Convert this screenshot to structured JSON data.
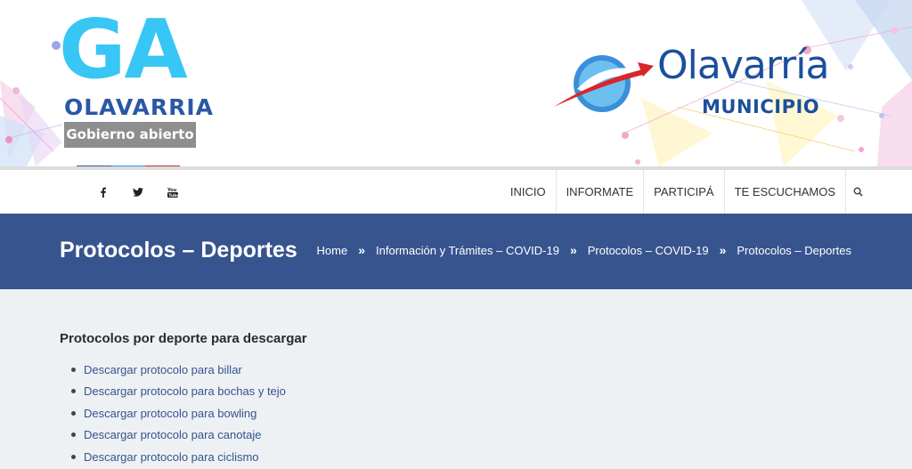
{
  "header": {
    "ga_logo": {
      "letters": "GA",
      "city": "OLAVARRIA",
      "tagline": "Gobierno abierto"
    },
    "muni_logo": {
      "name": "Olavarría",
      "subtitle": "MUNICIPIO"
    },
    "social_colors": [
      "#3b5998",
      "#1da1f2",
      "#c4302b"
    ]
  },
  "navbar": {
    "social": [
      {
        "icon": "facebook-icon",
        "glyph": "f"
      },
      {
        "icon": "twitter-icon",
        "glyph": "t"
      },
      {
        "icon": "youtube-icon",
        "glyph": "yt"
      }
    ],
    "menu": [
      "INICIO",
      "INFORMATE",
      "PARTICIPÁ",
      "TE ESCUCHAMOS"
    ],
    "search_icon": "search-icon"
  },
  "titlebar": {
    "title": "Protocolos – Deportes",
    "breadcrumb": [
      "Home",
      "Información y Trámites – COVID-19",
      "Protocolos – COVID-19",
      "Protocolos – Deportes"
    ],
    "separator": "»"
  },
  "content": {
    "heading": "Protocolos por deporte para descargar",
    "links": [
      "Descargar protocolo para billar",
      "Descargar protocolo para bochas y tejo",
      "Descargar protocolo para bowling",
      "Descargar protocolo para canotaje",
      "Descargar protocolo para ciclismo"
    ]
  },
  "colors": {
    "title_bar": "#38548f",
    "link": "#34548f",
    "ga_blue": "#38c6f4",
    "muni_blue": "#1c4f9c"
  }
}
